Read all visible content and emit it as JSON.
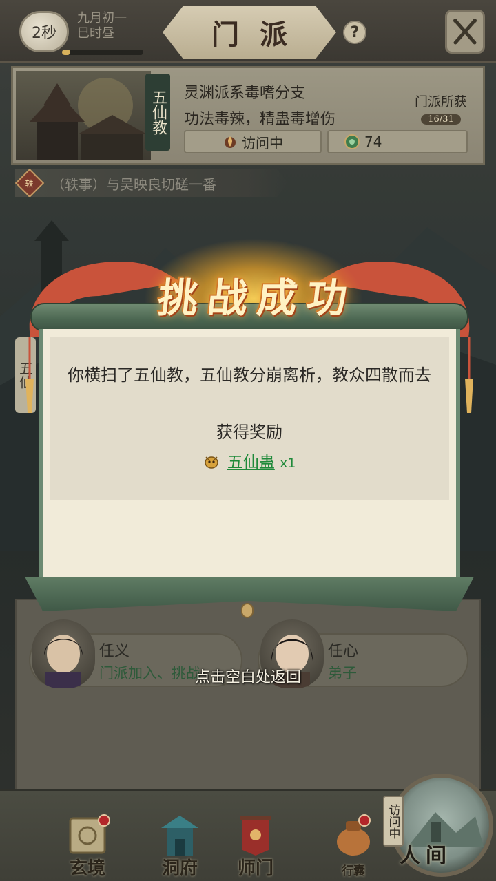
{
  "topbar": {
    "time": "2秒",
    "date_line1": "九月初一",
    "date_line2": "巳时昼",
    "title": "门派",
    "help": "?",
    "time_progress": 0.1
  },
  "sect": {
    "name_vertical": "五仙教",
    "desc_line1": "灵渊派系毒嗜分支",
    "desc_line2": "功法毒辣，精蛊毒增伤",
    "status": "访问中",
    "resource_value": "74",
    "gain_label": "门派所获",
    "gain_count": "16/31"
  },
  "anecdote": {
    "badge": "轶",
    "text": "（轶事）与吴映良切磋一番"
  },
  "side_tab": "五仙",
  "modal": {
    "title": "挑战成功",
    "message": "你横扫了五仙教，五仙教分崩离析，教众四散而去",
    "reward_title": "获得奖励",
    "reward_item": "五仙蛊",
    "reward_qty": "x1"
  },
  "members": [
    {
      "name": "任义",
      "sub": "门派加入、挑战"
    },
    {
      "name": "任心",
      "sub": "弟子"
    }
  ],
  "return_hint": "点击空白处返回",
  "nav": {
    "items": [
      {
        "label": "玄境"
      },
      {
        "label": "洞府"
      },
      {
        "label": "师门"
      },
      {
        "label": "行囊"
      }
    ],
    "visit_tag": "访问中",
    "human": "人间"
  },
  "colors": {
    "reward_green": "#1f8a3a",
    "badge_red": "#b3262a",
    "title_gold": "#fff2c4"
  }
}
